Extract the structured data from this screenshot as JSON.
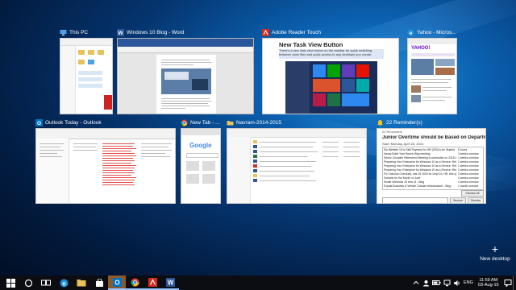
{
  "windows": [
    {
      "title": "This PC",
      "icon": "this-pc-icon"
    },
    {
      "title": "Windows 10 Blog - Word",
      "icon": "word-icon"
    },
    {
      "title": "Adobe Reader Touch",
      "icon": "adobe-reader-icon",
      "doc_heading": "New Task View Button",
      "doc_text": "There's a new task-view button on the taskbar for quick switching between open files and quick access to any desktops you create."
    },
    {
      "title": "Yahoo - Micros...",
      "icon": "edge-icon",
      "logo_text": "YAHOO!"
    },
    {
      "title": "Outlook Today - Outlook",
      "icon": "outlook-icon"
    },
    {
      "title": "New Tab - ...",
      "icon": "chrome-icon",
      "logo_text": "Google"
    },
    {
      "title": "Navram-2014-2015",
      "icon": "folder-icon"
    },
    {
      "title": "22 Reminder(s)",
      "icon": "bell-icon"
    }
  ],
  "reminder": {
    "header": "22 Reminders",
    "subject": "Junior Overtime should be Based on Departme...",
    "date": "Start: Monday, April 20, 2015",
    "items": [
      {
        "subject": "Sin Website 15 to Skill Payment for HR (003) to be Started",
        "due": "8 hours"
      },
      {
        "subject": "Kasey Bobb Year Reach-Way meeting",
        "due": "3 weeks overdue"
      },
      {
        "subject": "Senior Circulate Retirement Meeting is scheduled on 2015-11",
        "due": "1 weeks overdue"
      },
      {
        "subject": "Preparing Your Enterprise for Windows 10 as a Service: Retire...",
        "due": "2 weeks overdue"
      },
      {
        "subject": "Preparing Your Enterprise for Windows 10 as a Service: Retire...",
        "due": "2 weeks overdue"
      },
      {
        "subject": "Preparing Your Enterprise for Windows 10 as a Service: Retire...",
        "due": "2 weeks overdue"
      },
      {
        "subject": "Fix Calculus Overdued, last 15 2015 for Dept 15, HR, test up",
        "due": "3 weeks overdue"
      },
      {
        "subject": "Sobsets for the Month of June",
        "due": "4 weeks overdue"
      },
      {
        "subject": "Kindle Windows 10 new UI - Blog",
        "due": "4 weeks overdue"
      },
      {
        "subject": "Expats Business & Vehicle Tubular Infrastructure - Blog",
        "due": "1 month overdue"
      }
    ],
    "dismiss_all": "Dismiss All",
    "snooze": "Snooze",
    "dismiss": "Dismiss"
  },
  "new_desktop": {
    "label": "New desktop",
    "glyph": "+"
  },
  "taskbar": {
    "apps": [
      "start-icon",
      "search-circle-icon",
      "task-view-icon",
      "edge-icon",
      "file-explorer-icon",
      "store-icon",
      "outlook-icon",
      "chrome-icon",
      "adobe-reader-icon",
      "word-icon"
    ],
    "language": "ENG",
    "time": "11:59 AM",
    "date": "03-Aug-15"
  },
  "colors": {
    "accent": "#1e8fdc",
    "taskbar": "#0b0d12",
    "word": "#2b579a",
    "outlook": "#0072c6",
    "adobe": "#d32b1e",
    "active_underline": "#9ec7ff"
  }
}
